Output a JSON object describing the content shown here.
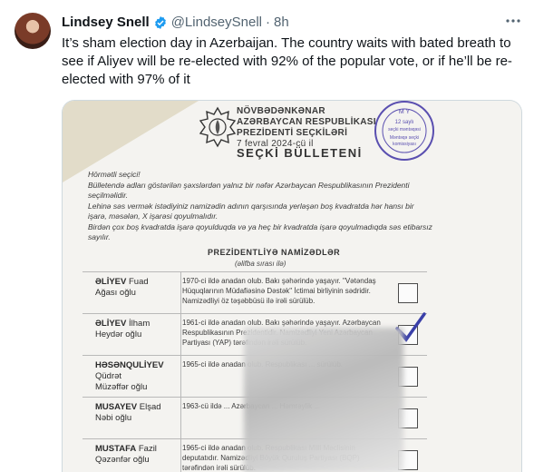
{
  "author": {
    "name": "Lindsey Snell",
    "handle": "@LindseySnell",
    "separator": "·",
    "time": "8h"
  },
  "menu_icon": "more-horizontal-icon",
  "tweet_text": "It’s sham election day in Azerbaijan. The country waits with bated breath to see if Aliyev will be re-elected with 92% of the popular vote, or if he’ll be re-elected with 97% of it",
  "colors": {
    "verified": "#1d9bf0",
    "stamp": "#5a4fb0",
    "check": "#3a3fa8"
  },
  "ballot": {
    "header_lines": [
      "NÖVBƏDƏNKƏNAR",
      "AZƏRBAYCAN RESPUBLİKASI",
      "PREZİDENTİ SEÇKİLƏRİ"
    ],
    "date": "7 fevral 2024-cü il",
    "title": "SEÇKİ BÜLLETENİ",
    "stamp_lines": [
      "12 saylı",
      "seçki məntəqəsi",
      "Məntəqə seçki",
      "komissiyası"
    ],
    "stamp_ring": "M Y",
    "intro": [
      "Hörmətli seçici!",
      "Bülletendə adları göstərilən şəxslərdən yalnız bir nəfər Azərbaycan Respublikasının Prezidenti seçilməlidir.",
      "Lehinə səs vermək istədiyiniz namizədin adının qarşısında yerləşən boş kvadratda hər hansı bir işarə, məsələn, X işarəsi qoyulmalıdır.",
      "Birdən çox boş kvadratda işarə qoyulduqda və ya heç bir kvadratda işarə qoyulmadıqda səs etibarsız sayılır."
    ],
    "section_title": "PREZİDENTLİYƏ NAMİZƏDLƏR",
    "section_sub": "(əlifba sırası ilə)",
    "candidates": [
      {
        "surname": "ƏLİYEV",
        "first": "Fuad",
        "patronymic": "Ağası oğlu",
        "desc": "1970-ci ildə anadan olub. Bakı şəhərində yaşayır. \"Vətəndaş Hüquqlarının Müdafiəsinə Dəstək\" İctimai birliyinin sədridir. Namizədliyi öz təşəbbüsü ilə irəli sürülüb.",
        "checked": false
      },
      {
        "surname": "ƏLİYEV",
        "first": "İlham",
        "patronymic": "Heydər oğlu",
        "desc": "1961-ci ildə anadan olub. Bakı şəhərində yaşayır. Azərbaycan Respublikasının Prezidentidir. Namizədliyi Yeni Azərbaycan Partiyası (YAP) tərəfindən irəli sürülüb.",
        "checked": true
      },
      {
        "surname": "HƏSƏNQULİYEV",
        "first": "Qüdrət",
        "patronymic": "Müzəffər oğlu",
        "desc": "1965-ci ildə anadan olub. Respublikası ... sürülüb.",
        "checked": false
      },
      {
        "surname": "MUSAYEV",
        "first": "Elşad",
        "patronymic": "Nəbi oğlu",
        "desc": "1963-cü ildə ... Azərbaycan ... Həmrəylik ...",
        "checked": false
      },
      {
        "surname": "MUSTAFA",
        "first": "Fazil",
        "patronymic": "Qəzənfər oğlu",
        "desc": "1965-ci ildə anadan olub. Respublikası Milli Məclisinin deputatıdır. Namizədliyi Böyük Quruluş Partiyası (BQP) tərəfindən irəli sürülüb.",
        "checked": false
      }
    ]
  }
}
